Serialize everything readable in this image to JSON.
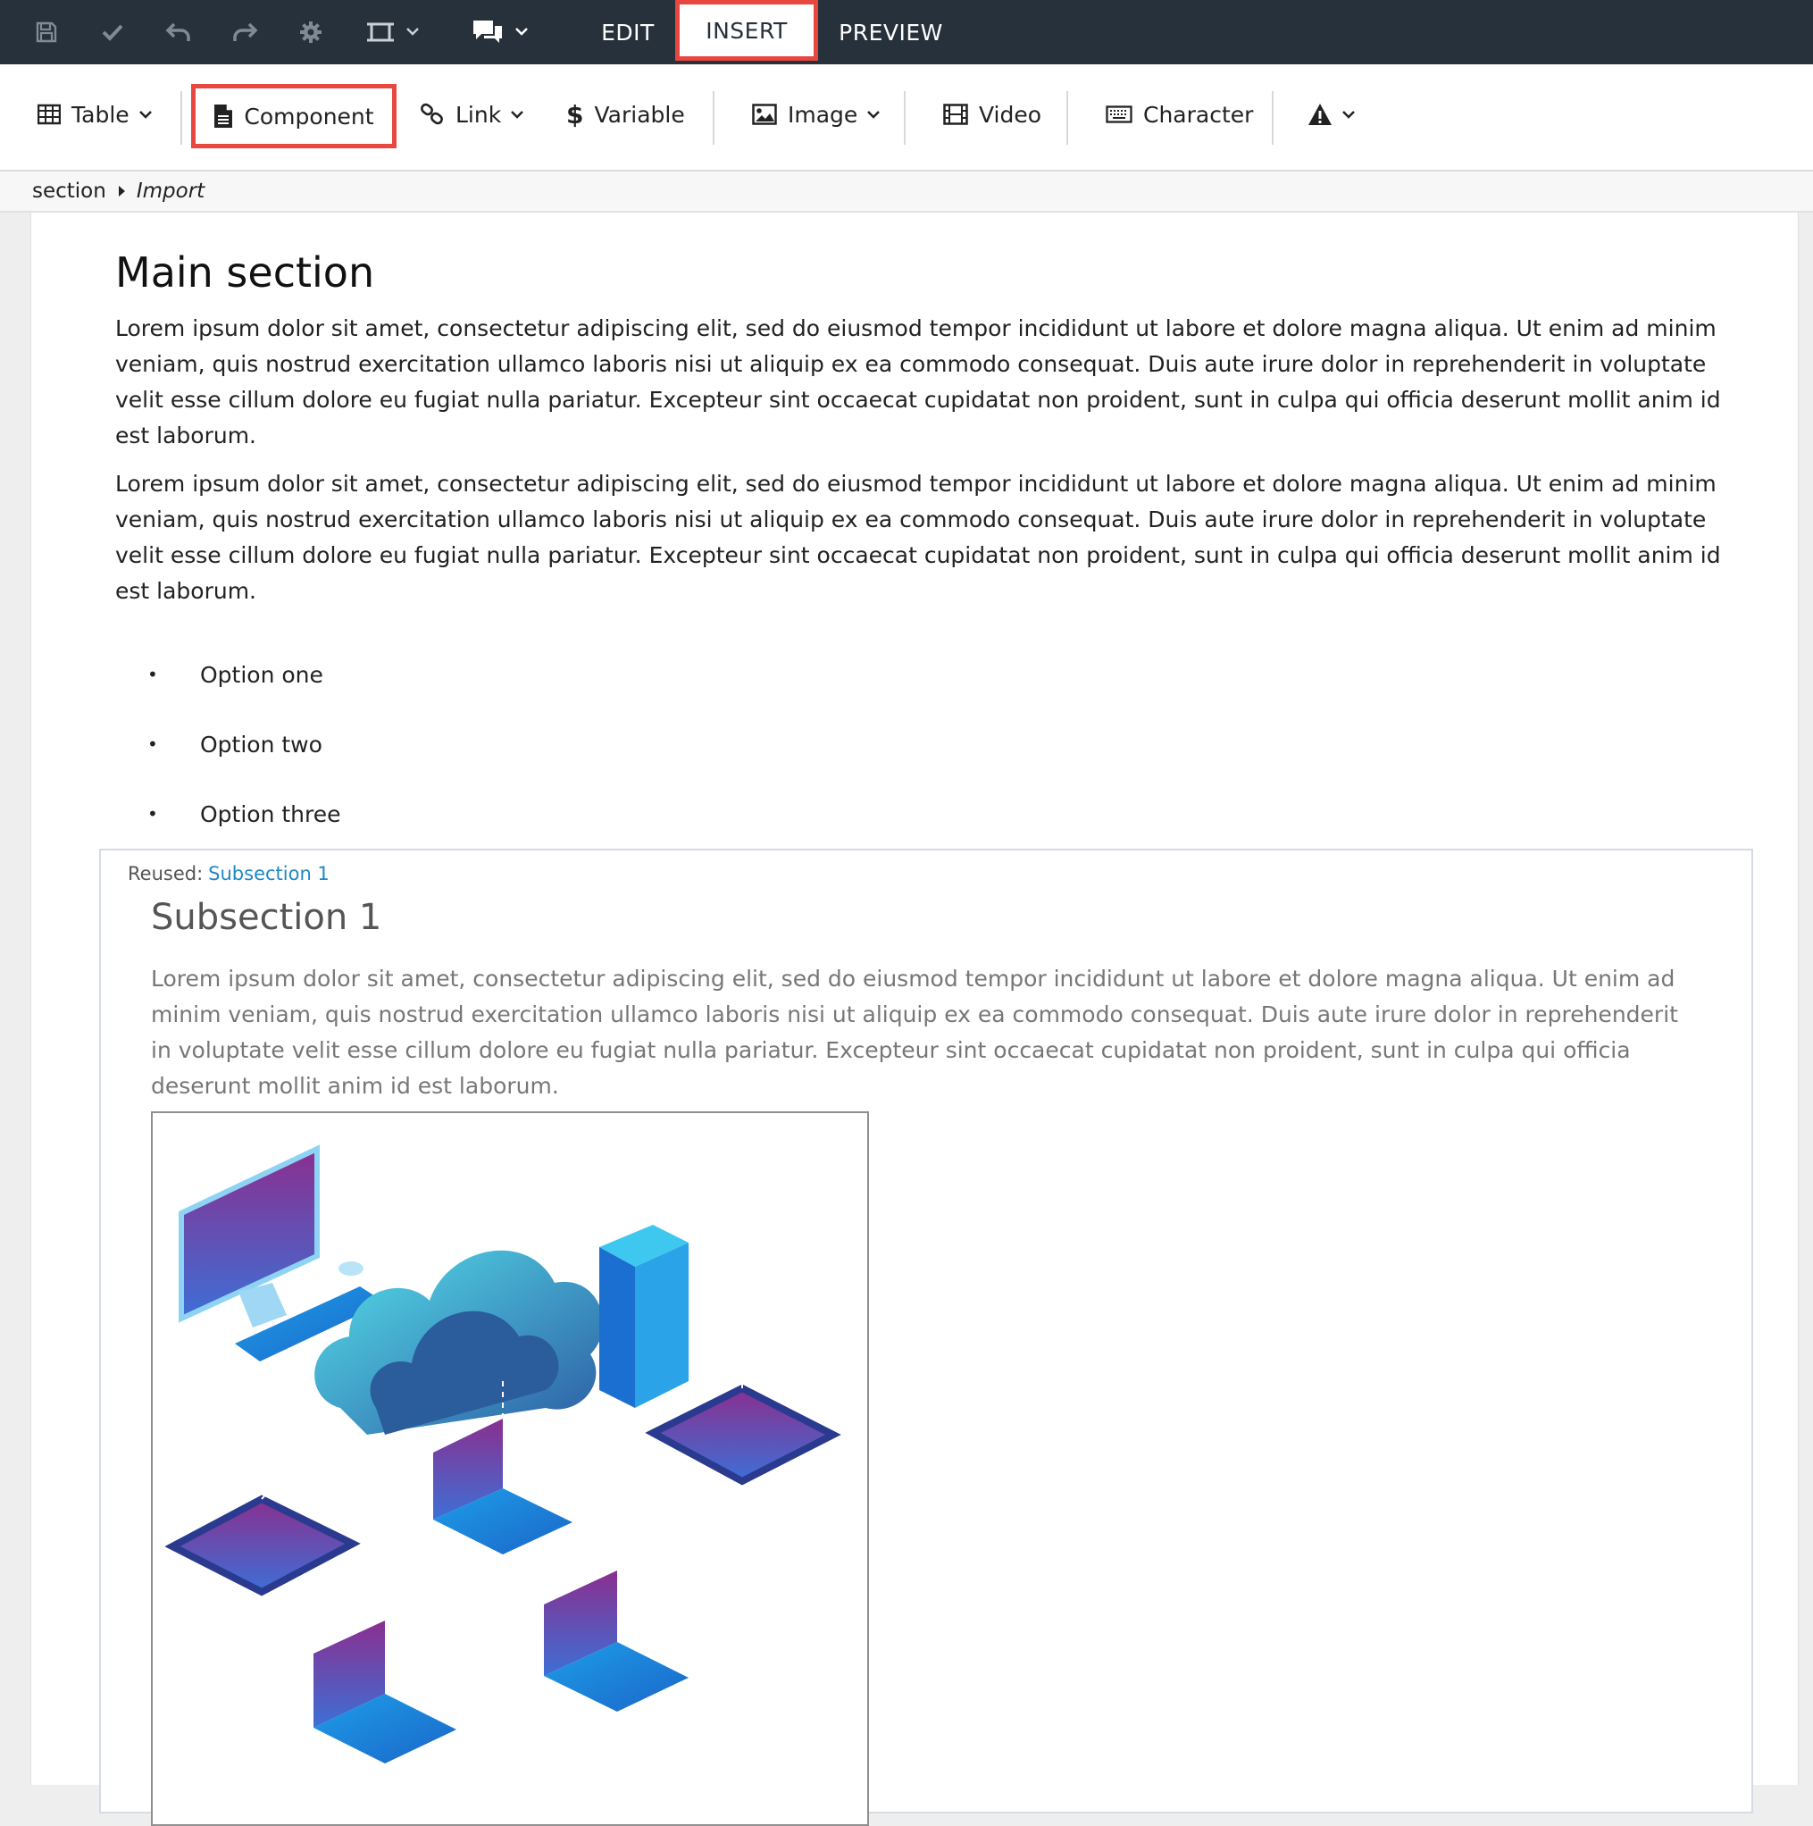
{
  "topbar": {
    "icons": [
      "save-icon",
      "check-icon",
      "undo-icon",
      "redo-icon",
      "gear-icon",
      "frame-icon",
      "comments-icon"
    ],
    "tabs": {
      "edit": "EDIT",
      "insert": "INSERT",
      "preview": "PREVIEW"
    },
    "active_tab": "INSERT",
    "highlight_color": "#e8473f",
    "background_color": "#27313b"
  },
  "toolbar": {
    "table": "Table",
    "component": "Component",
    "link": "Link",
    "variable": "Variable",
    "image": "Image",
    "video": "Video",
    "character": "Character",
    "warning_icon": "warning-icon"
  },
  "breadcrumb": {
    "root": "section",
    "current": "Import"
  },
  "document": {
    "title": "Main section",
    "paragraphs": [
      "Lorem ipsum dolor sit amet, consectetur adipiscing elit, sed do eiusmod tempor incididunt ut labore et dolore magna aliqua. Ut enim ad minim veniam, quis nostrud exercitation ullamco laboris nisi ut aliquip ex ea commodo consequat. Duis aute irure dolor in reprehenderit in voluptate velit esse cillum dolore eu fugiat nulla pariatur. Excepteur sint occaecat cupidatat non proident, sunt in culpa qui officia deserunt mollit anim id est laborum.",
      "Lorem ipsum dolor sit amet, consectetur adipiscing elit, sed do eiusmod tempor incididunt ut labore et dolore magna aliqua. Ut enim ad minim veniam, quis nostrud exercitation ullamco laboris nisi ut aliquip ex ea commodo consequat. Duis aute irure dolor in reprehenderit in voluptate velit esse cillum dolore eu fugiat nulla pariatur. Excepteur sint occaecat cupidatat non proident, sunt in culpa qui officia deserunt mollit anim id est laborum."
    ],
    "options": [
      "Option one",
      "Option two",
      "Option three"
    ],
    "bullet": "•"
  },
  "reused": {
    "label": "Reused:",
    "link": "Subsection 1",
    "title": "Subsection 1",
    "paragraph": "Lorem ipsum dolor sit amet, consectetur adipiscing elit, sed do eiusmod tempor incididunt ut labore et dolore magna aliqua. Ut enim ad minim veniam, quis nostrud exercitation ullamco laboris nisi ut aliquip ex ea commodo consequat. Duis aute irure dolor in reprehenderit in voluptate velit esse cillum dolore eu fugiat nulla pariatur. Excepteur sint occaecat cupidatat non proident, sunt in culpa qui officia deserunt mollit anim id est laborum.",
    "link_color": "#1e88c8"
  }
}
